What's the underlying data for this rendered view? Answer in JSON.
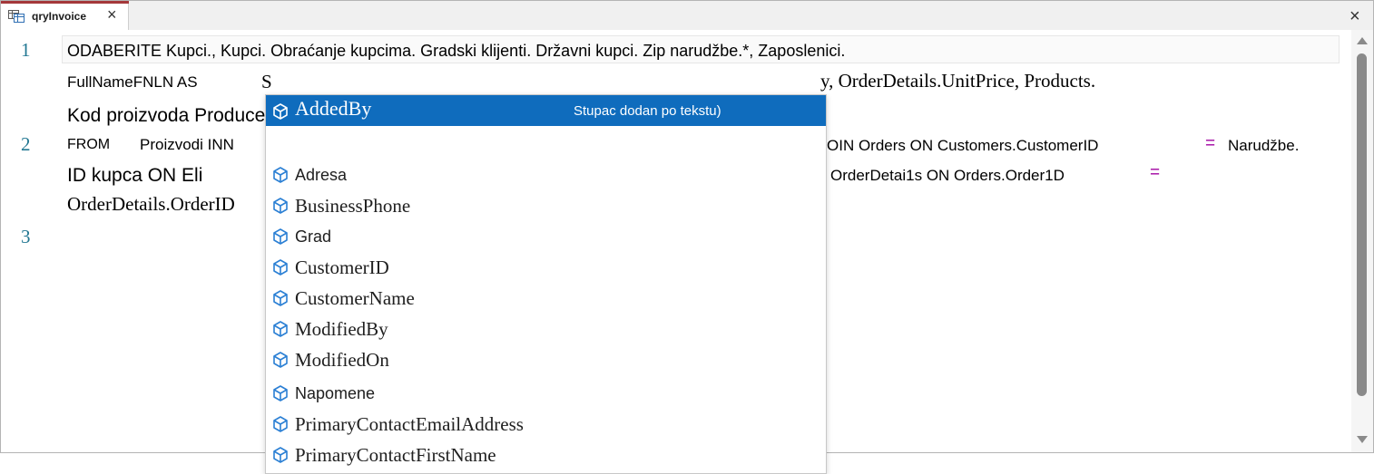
{
  "tab": {
    "title": "qryInvoice",
    "close_glyph": "×"
  },
  "window": {
    "close_glyph": "×"
  },
  "editor": {
    "line_numbers": [
      "1",
      "2",
      "3"
    ],
    "fragments": {
      "l1_select": "ODABERITE Kupci., Kupci. Obraćanje kupcima. Gradski klijenti. Državni kupci. Zip narudžbe.*, Zaposlenici.",
      "l1b_fullname": "FullNameFNLN AS",
      "l1b_s": "S",
      "l1b_tail": "y, OrderDetails.UnitPrice, Products.",
      "l1c_kod": "Kod proizvoda Produce e Added On",
      "l2_from": "FROM",
      "l2_proizvodi": "Proizvodi INN",
      "l2_join": "OIN Orders ON Customers.CustomerID",
      "l2_eq": "=",
      "l2_narudzbe": "Narudžbe.",
      "l2b_id": "ID kupca ON Eli",
      "l2b_orderdetai": "OrderDetai1s ON Orders.Order1D",
      "l2b_eq": "=",
      "l2c_orderdetails": "OrderDetails.OrderID"
    }
  },
  "autocomplete": {
    "items": [
      {
        "label": "AddedBy",
        "description": "Stupac dodan po tekstu)",
        "selected": true
      },
      {
        "label": "Adresa"
      },
      {
        "label": "BusinessPhone"
      },
      {
        "label": "Grad"
      },
      {
        "label": "CustomerID"
      },
      {
        "label": "CustomerName"
      },
      {
        "label": "ModifiedBy"
      },
      {
        "label": "ModifiedOn"
      },
      {
        "label": "Napomene"
      },
      {
        "label": "PrimaryContactEmailAddress"
      },
      {
        "label": "PrimaryContactFirstName"
      }
    ],
    "icon": "column-cube-icon"
  },
  "colors": {
    "accent_tab": "#a4373a",
    "selection": "#0f6cbd",
    "line_number": "#237893",
    "operator": "#a000a0",
    "icon_blue": "#2a7fd4"
  }
}
